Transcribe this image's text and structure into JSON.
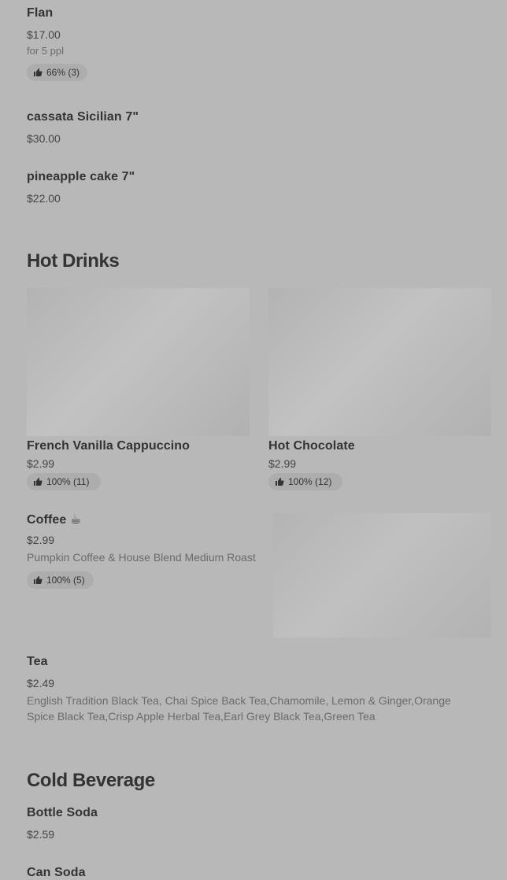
{
  "items_top": [
    {
      "name": "Flan",
      "price": "$17.00",
      "desc": "for 5 ppl",
      "rating": "66% (3)"
    },
    {
      "name": "cassata Sicilian 7\"",
      "price": "$30.00"
    },
    {
      "name": "pineapple cake 7\"",
      "price": "$22.00"
    }
  ],
  "hot_drinks": {
    "title": "Hot Drinks",
    "cards": [
      {
        "name": "French Vanilla Cappuccino",
        "price": "$2.99",
        "rating": "100% (11)"
      },
      {
        "name": "Hot Chocolate",
        "price": "$2.99",
        "rating": "100% (12)"
      }
    ],
    "coffee": {
      "name": "Coffee ☕",
      "price": "$2.99",
      "desc": "Pumpkin Coffee & House Blend Medium Roast",
      "rating": "100% (5)"
    },
    "tea": {
      "name": "Tea",
      "price": "$2.49",
      "desc": "English Tradition Black Tea, Chai Spice Back Tea,Chamomile, Lemon & Ginger,Orange Spice Black Tea,Crisp Apple Herbal Tea,Earl Grey Black Tea,Green Tea"
    }
  },
  "cold_beverage": {
    "title": "Cold Beverage",
    "items": [
      {
        "name": "Bottle Soda",
        "price": "$2.59"
      },
      {
        "name": "Can Soda"
      }
    ]
  },
  "icons": {
    "rating": "thumbs-up-icon"
  },
  "colors": {
    "background": "#b8b8b8",
    "text": "#333333",
    "badge": "#adadad"
  }
}
